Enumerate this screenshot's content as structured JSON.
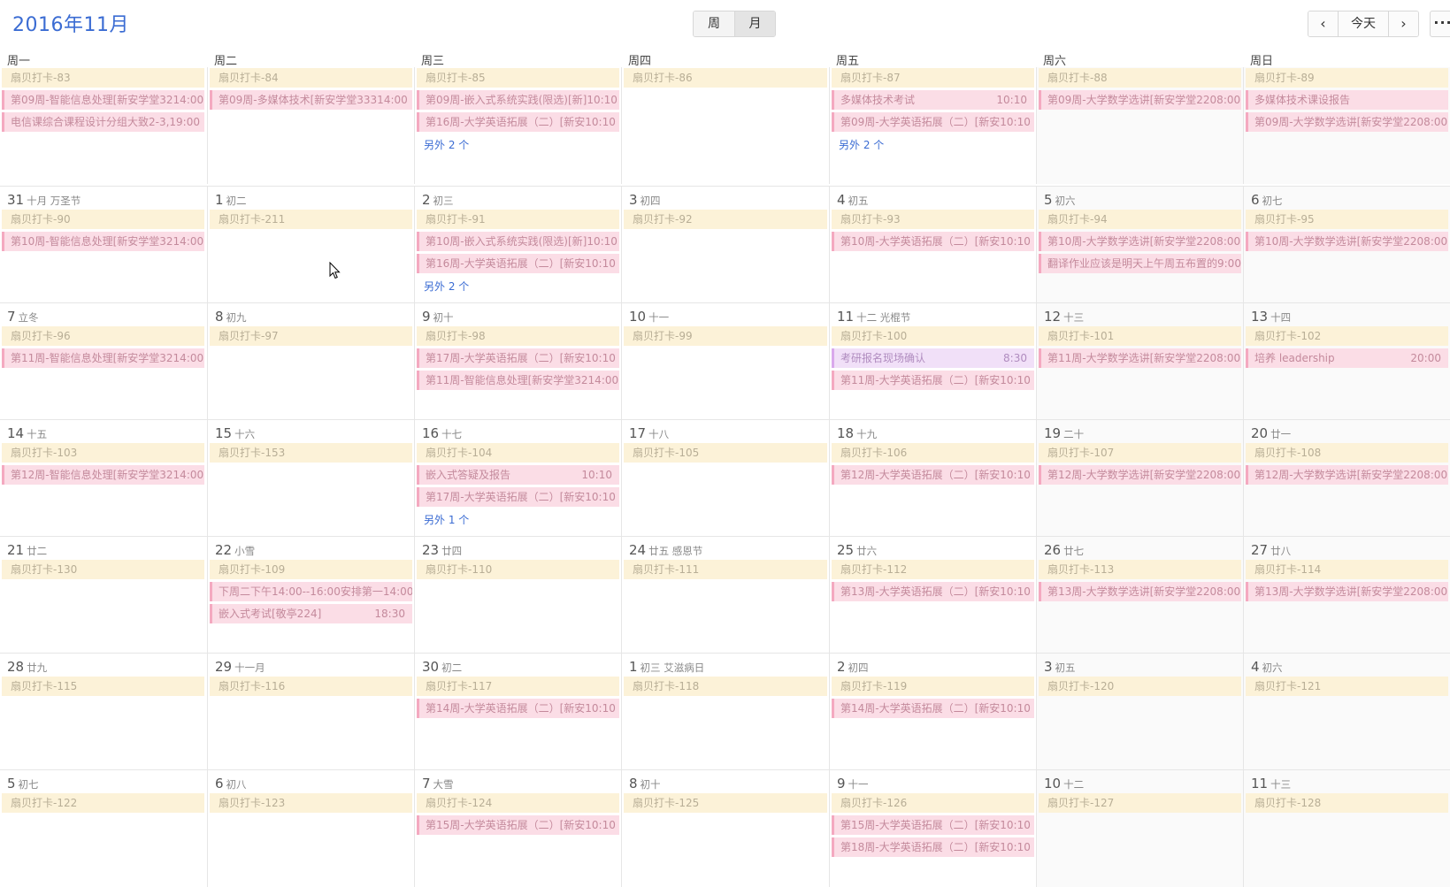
{
  "header": {
    "title": "2016年11月",
    "view_week": "周",
    "view_month": "月",
    "prev_icon": "‹",
    "today": "今天",
    "next_icon": "›",
    "more_icon": "···"
  },
  "weekdays": [
    "周一",
    "周二",
    "周三",
    "周四",
    "周五",
    "周六",
    "周日"
  ],
  "colors": {
    "accent": "#3b6cd3",
    "event_yellow": "#fcf2d8",
    "event_pink": "#fbdde6",
    "event_pink_border": "#f4a9c0",
    "event_purple": "#f1e0f8"
  },
  "weeks": [
    {
      "days": [
        {
          "num": "",
          "lunar": "",
          "events": [
            {
              "text": "扇贝打卡-83",
              "style": "yellow"
            },
            {
              "text": "第09周-智能信息处理[新安学堂3214:00",
              "style": "pink"
            },
            {
              "text": "电信课综合课程设计分组大致2-3,19:00",
              "style": "pink"
            }
          ],
          "more": ""
        },
        {
          "num": "",
          "lunar": "",
          "events": [
            {
              "text": "扇贝打卡-84",
              "style": "yellow"
            },
            {
              "text": "第09周-多媒体技术[新安学堂33314:00",
              "style": "pink"
            }
          ],
          "more": ""
        },
        {
          "num": "",
          "lunar": "",
          "events": [
            {
              "text": "扇贝打卡-85",
              "style": "yellow"
            },
            {
              "text": "第09周-嵌入式系统实践(限选)[新]10:10",
              "style": "pink"
            },
            {
              "text": "第16周-大学英语拓展（二）[新安10:10",
              "style": "pink"
            }
          ],
          "more": "另外 2 个"
        },
        {
          "num": "",
          "lunar": "",
          "events": [
            {
              "text": "扇贝打卡-86",
              "style": "yellow"
            }
          ],
          "more": ""
        },
        {
          "num": "",
          "lunar": "",
          "events": [
            {
              "text": "扇贝打卡-87",
              "style": "yellow"
            },
            {
              "text": "多媒体技术考试",
              "time": "10:10",
              "style": "pink"
            },
            {
              "text": "第09周-大学英语拓展（二）[新安10:10",
              "style": "pink"
            }
          ],
          "more": "另外 2 个"
        },
        {
          "num": "",
          "lunar": "",
          "events": [
            {
              "text": "扇贝打卡-88",
              "style": "yellow"
            },
            {
              "text": "第09周-大学数学选讲[新安学堂2208:00",
              "style": "pink"
            }
          ],
          "more": ""
        },
        {
          "num": "",
          "lunar": "",
          "events": [
            {
              "text": "扇贝打卡-89",
              "style": "yellow"
            },
            {
              "text": "多媒体技术课设报告",
              "style": "pink"
            },
            {
              "text": "第09周-大学数学选讲[新安学堂2208:00",
              "style": "pink"
            }
          ],
          "more": ""
        }
      ]
    },
    {
      "days": [
        {
          "num": "31",
          "lunar": "十月 万圣节",
          "events": [
            {
              "text": "扇贝打卡-90",
              "style": "yellow"
            },
            {
              "text": "第10周-智能信息处理[新安学堂3214:00",
              "style": "pink"
            }
          ],
          "more": ""
        },
        {
          "num": "1",
          "lunar": "初二",
          "events": [
            {
              "text": "扇贝打卡-211",
              "style": "yellow"
            }
          ],
          "more": ""
        },
        {
          "num": "2",
          "lunar": "初三",
          "events": [
            {
              "text": "扇贝打卡-91",
              "style": "yellow"
            },
            {
              "text": "第10周-嵌入式系统实践(限选)[新]10:10",
              "style": "pink"
            },
            {
              "text": "第16周-大学英语拓展（二）[新安10:10",
              "style": "pink"
            }
          ],
          "more": "另外 2 个"
        },
        {
          "num": "3",
          "lunar": "初四",
          "events": [
            {
              "text": "扇贝打卡-92",
              "style": "yellow"
            }
          ],
          "more": ""
        },
        {
          "num": "4",
          "lunar": "初五",
          "events": [
            {
              "text": "扇贝打卡-93",
              "style": "yellow"
            },
            {
              "text": "第10周-大学英语拓展（二）[新安10:10",
              "style": "pink"
            }
          ],
          "more": ""
        },
        {
          "num": "5",
          "lunar": "初六",
          "events": [
            {
              "text": "扇贝打卡-94",
              "style": "yellow"
            },
            {
              "text": "第10周-大学数学选讲[新安学堂2208:00",
              "style": "pink"
            },
            {
              "text": "翻译作业应该是明天上午周五布置的9:00",
              "style": "pink"
            }
          ],
          "more": ""
        },
        {
          "num": "6",
          "lunar": "初七",
          "events": [
            {
              "text": "扇贝打卡-95",
              "style": "yellow"
            },
            {
              "text": "第10周-大学数学选讲[新安学堂2208:00",
              "style": "pink"
            }
          ],
          "more": ""
        }
      ]
    },
    {
      "days": [
        {
          "num": "7",
          "lunar": "立冬",
          "events": [
            {
              "text": "扇贝打卡-96",
              "style": "yellow"
            },
            {
              "text": "第11周-智能信息处理[新安学堂3214:00",
              "style": "pink"
            }
          ],
          "more": ""
        },
        {
          "num": "8",
          "lunar": "初九",
          "events": [
            {
              "text": "扇贝打卡-97",
              "style": "yellow"
            }
          ],
          "more": ""
        },
        {
          "num": "9",
          "lunar": "初十",
          "events": [
            {
              "text": "扇贝打卡-98",
              "style": "yellow"
            },
            {
              "text": "第17周-大学英语拓展（二）[新安10:10",
              "style": "pink"
            },
            {
              "text": "第11周-智能信息处理[新安学堂3214:00",
              "style": "pink"
            }
          ],
          "more": ""
        },
        {
          "num": "10",
          "lunar": "十一",
          "events": [
            {
              "text": "扇贝打卡-99",
              "style": "yellow"
            }
          ],
          "more": ""
        },
        {
          "num": "11",
          "lunar": "十二 光棍节",
          "events": [
            {
              "text": "扇贝打卡-100",
              "style": "yellow"
            },
            {
              "text": "考研报名现场确认",
              "time": "8:30",
              "style": "purple"
            },
            {
              "text": "第11周-大学英语拓展（二）[新安10:10",
              "style": "pink"
            }
          ],
          "more": ""
        },
        {
          "num": "12",
          "lunar": "十三",
          "events": [
            {
              "text": "扇贝打卡-101",
              "style": "yellow"
            },
            {
              "text": "第11周-大学数学选讲[新安学堂2208:00",
              "style": "pink"
            }
          ],
          "more": ""
        },
        {
          "num": "13",
          "lunar": "十四",
          "events": [
            {
              "text": "扇贝打卡-102",
              "style": "yellow"
            },
            {
              "text": "培养 leadership",
              "time": "20:00",
              "style": "pink"
            }
          ],
          "more": ""
        }
      ]
    },
    {
      "days": [
        {
          "num": "14",
          "lunar": "十五",
          "events": [
            {
              "text": "扇贝打卡-103",
              "style": "yellow"
            },
            {
              "text": "第12周-智能信息处理[新安学堂3214:00",
              "style": "pink"
            }
          ],
          "more": ""
        },
        {
          "num": "15",
          "lunar": "十六",
          "events": [
            {
              "text": "扇贝打卡-153",
              "style": "yellow"
            }
          ],
          "more": ""
        },
        {
          "num": "16",
          "lunar": "十七",
          "events": [
            {
              "text": "扇贝打卡-104",
              "style": "yellow"
            },
            {
              "text": "嵌入式答疑及报告",
              "time": "10:10",
              "style": "pink"
            },
            {
              "text": "第17周-大学英语拓展（二）[新安10:10",
              "style": "pink"
            }
          ],
          "more": "另外 1 个"
        },
        {
          "num": "17",
          "lunar": "十八",
          "events": [
            {
              "text": "扇贝打卡-105",
              "style": "yellow"
            }
          ],
          "more": ""
        },
        {
          "num": "18",
          "lunar": "十九",
          "events": [
            {
              "text": "扇贝打卡-106",
              "style": "yellow"
            },
            {
              "text": "第12周-大学英语拓展（二）[新安10:10",
              "style": "pink"
            }
          ],
          "more": ""
        },
        {
          "num": "19",
          "lunar": "二十",
          "events": [
            {
              "text": "扇贝打卡-107",
              "style": "yellow"
            },
            {
              "text": "第12周-大学数学选讲[新安学堂2208:00",
              "style": "pink"
            }
          ],
          "more": ""
        },
        {
          "num": "20",
          "lunar": "廿一",
          "events": [
            {
              "text": "扇贝打卡-108",
              "style": "yellow"
            },
            {
              "text": "第12周-大学数学选讲[新安学堂2208:00",
              "style": "pink"
            }
          ],
          "more": ""
        }
      ]
    },
    {
      "days": [
        {
          "num": "21",
          "lunar": "廿二",
          "events": [
            {
              "text": "扇贝打卡-130",
              "style": "yellow"
            }
          ],
          "more": ""
        },
        {
          "num": "22",
          "lunar": "小雪",
          "events": [
            {
              "text": "扇贝打卡-109",
              "style": "yellow"
            },
            {
              "text": "下周二下午14:00--16:00安排第一14:00",
              "style": "pink"
            },
            {
              "text": "嵌入式考试[敬亭224]",
              "time": "18:30",
              "style": "pink"
            }
          ],
          "more": ""
        },
        {
          "num": "23",
          "lunar": "廿四",
          "events": [
            {
              "text": "扇贝打卡-110",
              "style": "yellow"
            }
          ],
          "more": ""
        },
        {
          "num": "24",
          "lunar": "廿五 感恩节",
          "events": [
            {
              "text": "扇贝打卡-111",
              "style": "yellow"
            }
          ],
          "more": ""
        },
        {
          "num": "25",
          "lunar": "廿六",
          "events": [
            {
              "text": "扇贝打卡-112",
              "style": "yellow"
            },
            {
              "text": "第13周-大学英语拓展（二）[新安10:10",
              "style": "pink"
            }
          ],
          "more": ""
        },
        {
          "num": "26",
          "lunar": "廿七",
          "events": [
            {
              "text": "扇贝打卡-113",
              "style": "yellow"
            },
            {
              "text": "第13周-大学数学选讲[新安学堂2208:00",
              "style": "pink"
            }
          ],
          "more": ""
        },
        {
          "num": "27",
          "lunar": "廿八",
          "events": [
            {
              "text": "扇贝打卡-114",
              "style": "yellow"
            },
            {
              "text": "第13周-大学数学选讲[新安学堂2208:00",
              "style": "pink"
            }
          ],
          "more": ""
        }
      ]
    },
    {
      "days": [
        {
          "num": "28",
          "lunar": "廿九",
          "events": [
            {
              "text": "扇贝打卡-115",
              "style": "yellow"
            }
          ],
          "more": ""
        },
        {
          "num": "29",
          "lunar": "十一月",
          "events": [
            {
              "text": "扇贝打卡-116",
              "style": "yellow"
            }
          ],
          "more": ""
        },
        {
          "num": "30",
          "lunar": "初二",
          "events": [
            {
              "text": "扇贝打卡-117",
              "style": "yellow"
            },
            {
              "text": "第14周-大学英语拓展（二）[新安10:10",
              "style": "pink"
            }
          ],
          "more": ""
        },
        {
          "num": "1",
          "lunar": "初三 艾滋病日",
          "events": [
            {
              "text": "扇贝打卡-118",
              "style": "yellow"
            }
          ],
          "more": ""
        },
        {
          "num": "2",
          "lunar": "初四",
          "events": [
            {
              "text": "扇贝打卡-119",
              "style": "yellow"
            },
            {
              "text": "第14周-大学英语拓展（二）[新安10:10",
              "style": "pink"
            }
          ],
          "more": ""
        },
        {
          "num": "3",
          "lunar": "初五",
          "events": [
            {
              "text": "扇贝打卡-120",
              "style": "yellow"
            }
          ],
          "more": ""
        },
        {
          "num": "4",
          "lunar": "初六",
          "events": [
            {
              "text": "扇贝打卡-121",
              "style": "yellow"
            }
          ],
          "more": ""
        }
      ]
    },
    {
      "days": [
        {
          "num": "5",
          "lunar": "初七",
          "events": [
            {
              "text": "扇贝打卡-122",
              "style": "yellow"
            }
          ],
          "more": ""
        },
        {
          "num": "6",
          "lunar": "初八",
          "events": [
            {
              "text": "扇贝打卡-123",
              "style": "yellow"
            }
          ],
          "more": ""
        },
        {
          "num": "7",
          "lunar": "大雪",
          "events": [
            {
              "text": "扇贝打卡-124",
              "style": "yellow"
            },
            {
              "text": "第15周-大学英语拓展（二）[新安10:10",
              "style": "pink"
            }
          ],
          "more": ""
        },
        {
          "num": "8",
          "lunar": "初十",
          "events": [
            {
              "text": "扇贝打卡-125",
              "style": "yellow"
            }
          ],
          "more": ""
        },
        {
          "num": "9",
          "lunar": "十一",
          "events": [
            {
              "text": "扇贝打卡-126",
              "style": "yellow"
            },
            {
              "text": "第15周-大学英语拓展（二）[新安10:10",
              "style": "pink"
            },
            {
              "text": "第18周-大学英语拓展（二）[新安10:10",
              "style": "pink"
            }
          ],
          "more": ""
        },
        {
          "num": "10",
          "lunar": "十二",
          "events": [
            {
              "text": "扇贝打卡-127",
              "style": "yellow"
            }
          ],
          "more": ""
        },
        {
          "num": "11",
          "lunar": "十三",
          "events": [
            {
              "text": "扇贝打卡-128",
              "style": "yellow"
            }
          ],
          "more": ""
        }
      ]
    }
  ]
}
